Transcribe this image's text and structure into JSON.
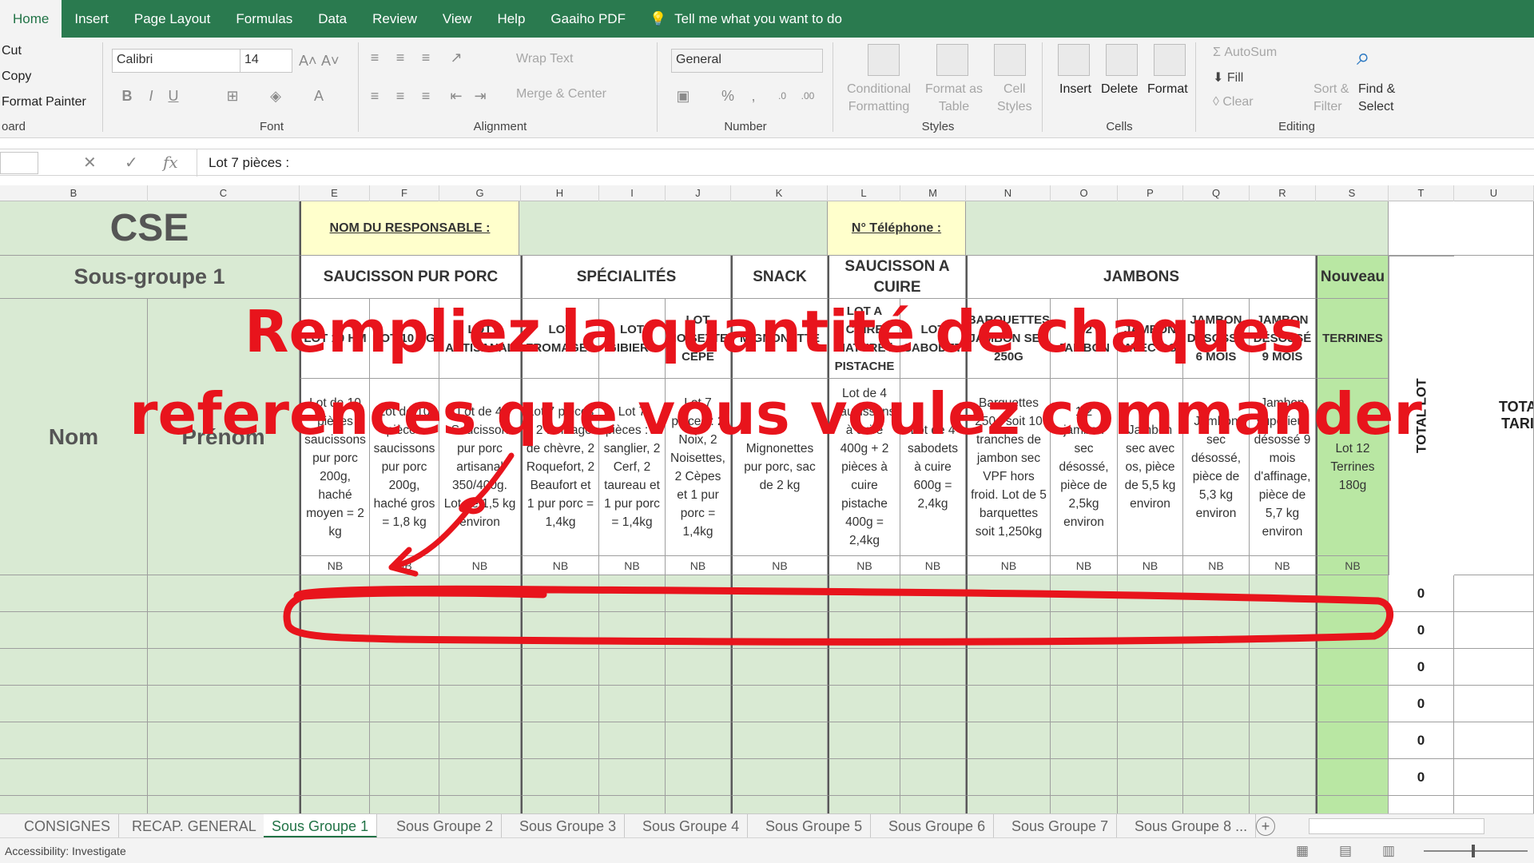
{
  "ribbon_tabs": [
    "Home",
    "Insert",
    "Page Layout",
    "Formulas",
    "Data",
    "Review",
    "View",
    "Help",
    "Gaaiho PDF"
  ],
  "tell_me": "Tell me what you want to do",
  "clipboard": {
    "cut": "Cut",
    "copy": "Copy",
    "format_painter": "Format Painter",
    "label": "oard"
  },
  "font": {
    "name": "Calibri",
    "size": "14",
    "label": "Font",
    "bold": "B",
    "italic": "I",
    "underline": "U",
    "grow": "A˄",
    "shrink": "A˅",
    "color": "A"
  },
  "alignment": {
    "wrap": "Wrap Text",
    "merge": "Merge & Center",
    "label": "Alignment"
  },
  "number": {
    "format": "General",
    "percent": "%",
    "comma": ",",
    "label": "Number"
  },
  "styles": {
    "conditional": "Conditional\nFormatting",
    "format_table": "Format as\nTable",
    "cell_styles": "Cell\nStyles",
    "label": "Styles"
  },
  "cells": {
    "insert": "Insert",
    "delete": "Delete",
    "format": "Format",
    "label": "Cells"
  },
  "editing": {
    "autosum": "AutoSum",
    "fill": "Fill",
    "clear": "Clear",
    "sort": "Sort &\nFilter",
    "find": "Find &\nSelect",
    "label": "Editing"
  },
  "formula_bar": {
    "fx": "fx",
    "content": "Lot 7 pièces :"
  },
  "columns": [
    "B",
    "C",
    "E",
    "F",
    "G",
    "H",
    "I",
    "J",
    "K",
    "L",
    "M",
    "N",
    "O",
    "P",
    "Q",
    "R",
    "S",
    "T",
    "U"
  ],
  "sheet": {
    "cse": "CSE",
    "responsable_label": "NOM DU RESPONSABLE :",
    "telephone_label": "N° Téléphone :",
    "sous_groupe": "Sous-groupe 1",
    "nom": "Nom",
    "prenom": "Prénom",
    "groups": [
      "SAUCISSON PUR PORC",
      "SPÉCIALITÉS",
      "SNACK",
      "SAUCISSON A CUIRE",
      "JAMBONS",
      "Nouveau"
    ],
    "products": [
      "LOT 10 HM",
      "LOT 10 HG",
      "LOT ARTISANAL",
      "LOT FROMAGES",
      "LOT GIBIERS",
      "LOT NOISETTE CEPE",
      "MIGNONETTE",
      "LOT A CUIRE NATURE / PISTACHE",
      "LOT SABODET",
      "BARQUETTES JAMBON SEC 250G",
      "1/2 JAMBON",
      "JAMBON AVEC OS",
      "JAMBON DÉSOSSÉ 6 MOIS",
      "JAMBON DÉSOSSÉ 9 MOIS",
      "TERRINES"
    ],
    "descriptions": [
      "Lot de 10 pièces saucissons pur porc 200g, haché moyen = 2 kg",
      "Lot de 10 pièces saucissons pur porc 200g, haché gros = 1,8 kg",
      "Lot de 4 Saucisson pur porc artisanal 350/400g. Lot de 1,5 kg environ",
      "Lot 7 pièces : 2 fromage de chèvre, 2 Roquefort, 2 Beaufort et 1 pur porc = 1,4kg",
      "Lot 7 pièces : 2 sanglier, 2 Cerf, 2 taureau et 1 pur porc = 1,4kg",
      "Lot 7 pièces : 2 Noix, 2 Noisettes, 2 Cèpes et 1 pur porc = 1,4kg",
      "Mignonettes pur porc, sac de 2 kg",
      "Lot de 4 saucissons à cuire 400g + 2 pièces à cuire pistache 400g = 2,4kg",
      "Lot de 4 sabodets à cuire 600g = 2,4kg",
      "Barquettes 250g soit 10 tranches de jambon sec VPF hors froid. Lot de 5 barquettes soit 1,250kg",
      "1/2 jambon sec désossé, pièce de 2,5kg environ",
      "Jambon sec avec os, pièce de 5,5 kg environ",
      "Jambon sec désossé, pièce de 5,3 kg environ",
      "Jambon superieur désossé 9 mois d'affinage, pièce de 5,7 kg environ",
      "Lot 12 Terrines 180g"
    ],
    "nb": "NB",
    "total_lot": "TOTAL LOT",
    "total_tarif": "TOTAL TARIF",
    "totals": [
      "0",
      "0",
      "0",
      "0",
      "0",
      "0"
    ]
  },
  "overlay": {
    "line1": "Rempliez la quantité de chaques",
    "line2": "references que vous voulez commander"
  },
  "sheet_tabs": [
    "CONSIGNES",
    "RECAP. GENERAL",
    "Sous Groupe 1",
    "Sous Groupe 2",
    "Sous Groupe 3",
    "Sous Groupe 4",
    "Sous Groupe 5",
    "Sous Groupe 6",
    "Sous Groupe 7",
    "Sous Groupe 8 ..."
  ],
  "active_sheet": "Sous Groupe 1",
  "status": "Accessibility: Investigate",
  "colors": {
    "ribbon": "#2a7a4f",
    "cell_green": "#d9ead3",
    "cell_yellow": "#ffffcc",
    "accent_green": "#b9e7a3",
    "overlay_red": "#e8141c"
  }
}
